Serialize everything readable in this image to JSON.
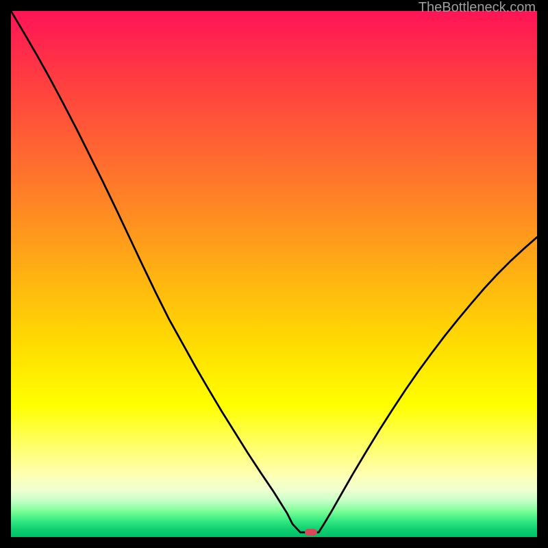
{
  "watermark": {
    "text": "TheBottleneck.com"
  },
  "marker": {
    "x_pct": 57.0,
    "y_pct": 99.1,
    "color": "#d9475a"
  },
  "chart_data": {
    "type": "line",
    "title": "",
    "xlabel": "",
    "ylabel": "",
    "xlim": [
      0,
      100
    ],
    "ylim": [
      0,
      100
    ],
    "grid": false,
    "legend": false,
    "background_gradient": {
      "direction": "vertical",
      "description": "bottleneck severity heatmap (red = high bottleneck at low x, green = balanced at high x)",
      "stops": [
        {
          "pos": 0,
          "color": "#ff1457"
        },
        {
          "pos": 14,
          "color": "#ff4040"
        },
        {
          "pos": 40,
          "color": "#ff9020"
        },
        {
          "pos": 64,
          "color": "#ffde00"
        },
        {
          "pos": 82,
          "color": "#ffff60"
        },
        {
          "pos": 93,
          "color": "#c8ffc8"
        },
        {
          "pos": 100,
          "color": "#00c068"
        }
      ]
    },
    "series": [
      {
        "name": "bottleneck-curve",
        "stroke": "#000000",
        "x": [
          0,
          2.5,
          5,
          7.5,
          10,
          12.5,
          15,
          17.5,
          20,
          22.5,
          25,
          27.5,
          30,
          32.5,
          35,
          37.5,
          40,
          42.5,
          45,
          47.5,
          50,
          52.5,
          53.5,
          55,
          58.5,
          59.5,
          61,
          63,
          65,
          67.5,
          70,
          72.5,
          75,
          77.5,
          80,
          82.5,
          85,
          87.5,
          90,
          92.5,
          95,
          97.5,
          100
        ],
        "y": [
          100,
          95.8,
          91.5,
          87,
          82.3,
          77.5,
          72.5,
          67.5,
          62.3,
          57,
          51.7,
          46.5,
          41.5,
          37,
          32.5,
          28.2,
          24,
          20,
          16,
          12.2,
          8.5,
          4.5,
          2.5,
          0.9,
          0.9,
          2.5,
          5,
          8.5,
          12,
          16.2,
          20.3,
          24.2,
          28,
          31.6,
          35,
          38.3,
          41.4,
          44.4,
          47.3,
          50,
          52.5,
          54.8,
          57
        ]
      }
    ],
    "marker_point": {
      "x": 57.0,
      "y": 0.9,
      "color": "#d9475a"
    }
  }
}
